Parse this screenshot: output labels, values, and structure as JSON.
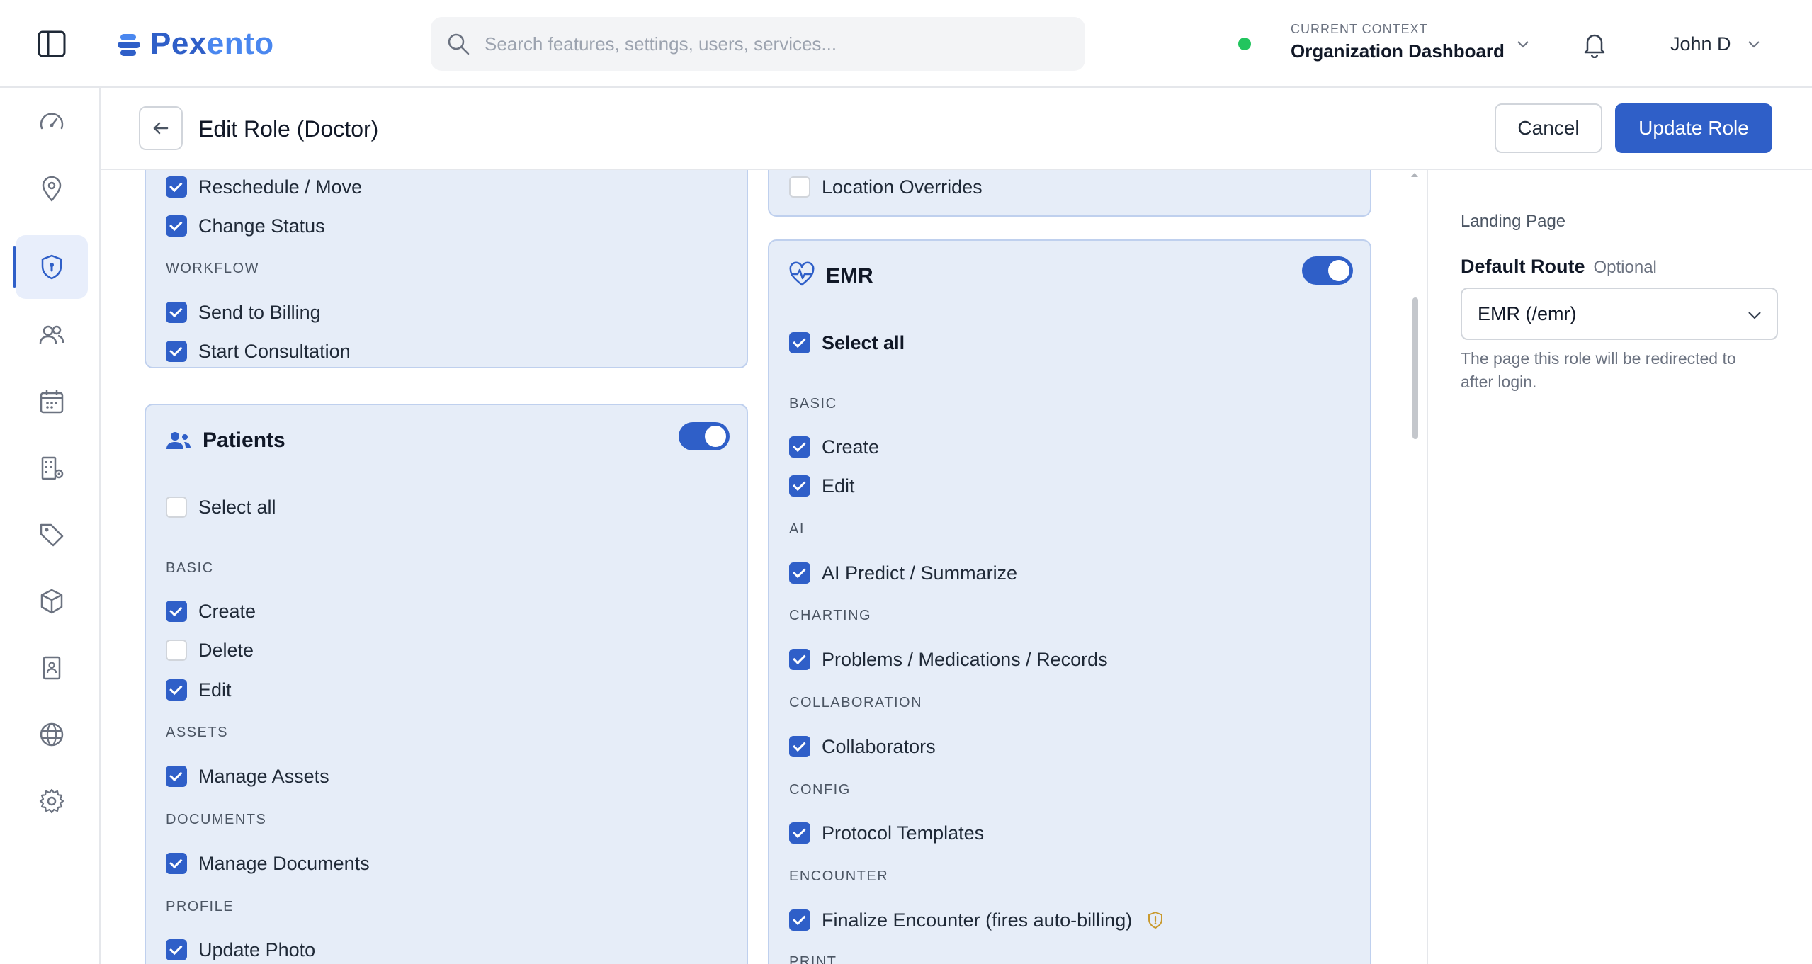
{
  "brand": {
    "name_part1": "Pex",
    "name_part2": "ento",
    "accent": "#2f5fc8",
    "accent_light": "#4a87ef"
  },
  "search": {
    "placeholder": "Search features, settings, users, services..."
  },
  "context": {
    "label": "CURRENT CONTEXT",
    "value": "Organization Dashboard",
    "status_color": "#22c55e"
  },
  "user": {
    "name": "John D"
  },
  "nav": {
    "items": [
      {
        "name": "dashboard",
        "icon": "gauge-icon"
      },
      {
        "name": "locations",
        "icon": "map-pin-icon"
      },
      {
        "name": "roles",
        "icon": "shield-icon",
        "active": true
      },
      {
        "name": "users",
        "icon": "users-icon"
      },
      {
        "name": "calendar",
        "icon": "calendar-icon"
      },
      {
        "name": "organization",
        "icon": "building-gear-icon"
      },
      {
        "name": "tags",
        "icon": "tag-icon"
      },
      {
        "name": "products",
        "icon": "box-icon"
      },
      {
        "name": "contacts",
        "icon": "contact-card-icon"
      },
      {
        "name": "web",
        "icon": "globe-icon"
      },
      {
        "name": "settings",
        "icon": "gear-icon"
      }
    ]
  },
  "page": {
    "title": "Edit Role (Doctor)",
    "cancel_label": "Cancel",
    "update_label": "Update Role"
  },
  "appointments_card": {
    "items": [
      {
        "label": "Reschedule / Move",
        "checked": true
      },
      {
        "label": "Change Status",
        "checked": true
      }
    ],
    "workflow_heading": "WORKFLOW",
    "workflow_items": [
      {
        "label": "Send to Billing",
        "checked": true
      },
      {
        "label": "Start Consultation",
        "checked": true
      }
    ]
  },
  "patients_card": {
    "title": "Patients",
    "enabled": true,
    "select_all": {
      "label": "Select all",
      "checked": false
    },
    "basic_heading": "BASIC",
    "basic": [
      {
        "label": "Create",
        "checked": true
      },
      {
        "label": "Delete",
        "checked": false
      },
      {
        "label": "Edit",
        "checked": true
      }
    ],
    "assets_heading": "ASSETS",
    "assets": [
      {
        "label": "Manage Assets",
        "checked": true
      }
    ],
    "documents_heading": "DOCUMENTS",
    "documents": [
      {
        "label": "Manage Documents",
        "checked": true
      }
    ],
    "profile_heading": "PROFILE",
    "profile": [
      {
        "label": "Update Photo",
        "checked": true
      }
    ]
  },
  "locations_card": {
    "items": [
      {
        "label": "Location Overrides",
        "checked": false
      }
    ]
  },
  "emr_card": {
    "title": "EMR",
    "enabled": true,
    "select_all": {
      "label": "Select all",
      "checked": true
    },
    "basic_heading": "BASIC",
    "basic": [
      {
        "label": "Create",
        "checked": true
      },
      {
        "label": "Edit",
        "checked": true
      }
    ],
    "ai_heading": "AI",
    "ai": [
      {
        "label": "AI Predict / Summarize",
        "checked": true
      }
    ],
    "charting_heading": "CHARTING",
    "charting": [
      {
        "label": "Problems / Medications / Records",
        "checked": true
      }
    ],
    "collaboration_heading": "COLLABORATION",
    "collaboration": [
      {
        "label": "Collaborators",
        "checked": true
      }
    ],
    "config_heading": "CONFIG",
    "config": [
      {
        "label": "Protocol Templates",
        "checked": true
      }
    ],
    "encounter_heading": "ENCOUNTER",
    "encounter": [
      {
        "label": "Finalize Encounter (fires auto-billing)",
        "checked": true,
        "warning_icon": "shield-alert-icon"
      }
    ],
    "print_heading": "PRINT"
  },
  "landing": {
    "heading": "Landing Page",
    "route_label": "Default Route",
    "route_optional": "Optional",
    "route_value": "EMR (/emr)",
    "help": "The page this role will be redirected to after login."
  }
}
